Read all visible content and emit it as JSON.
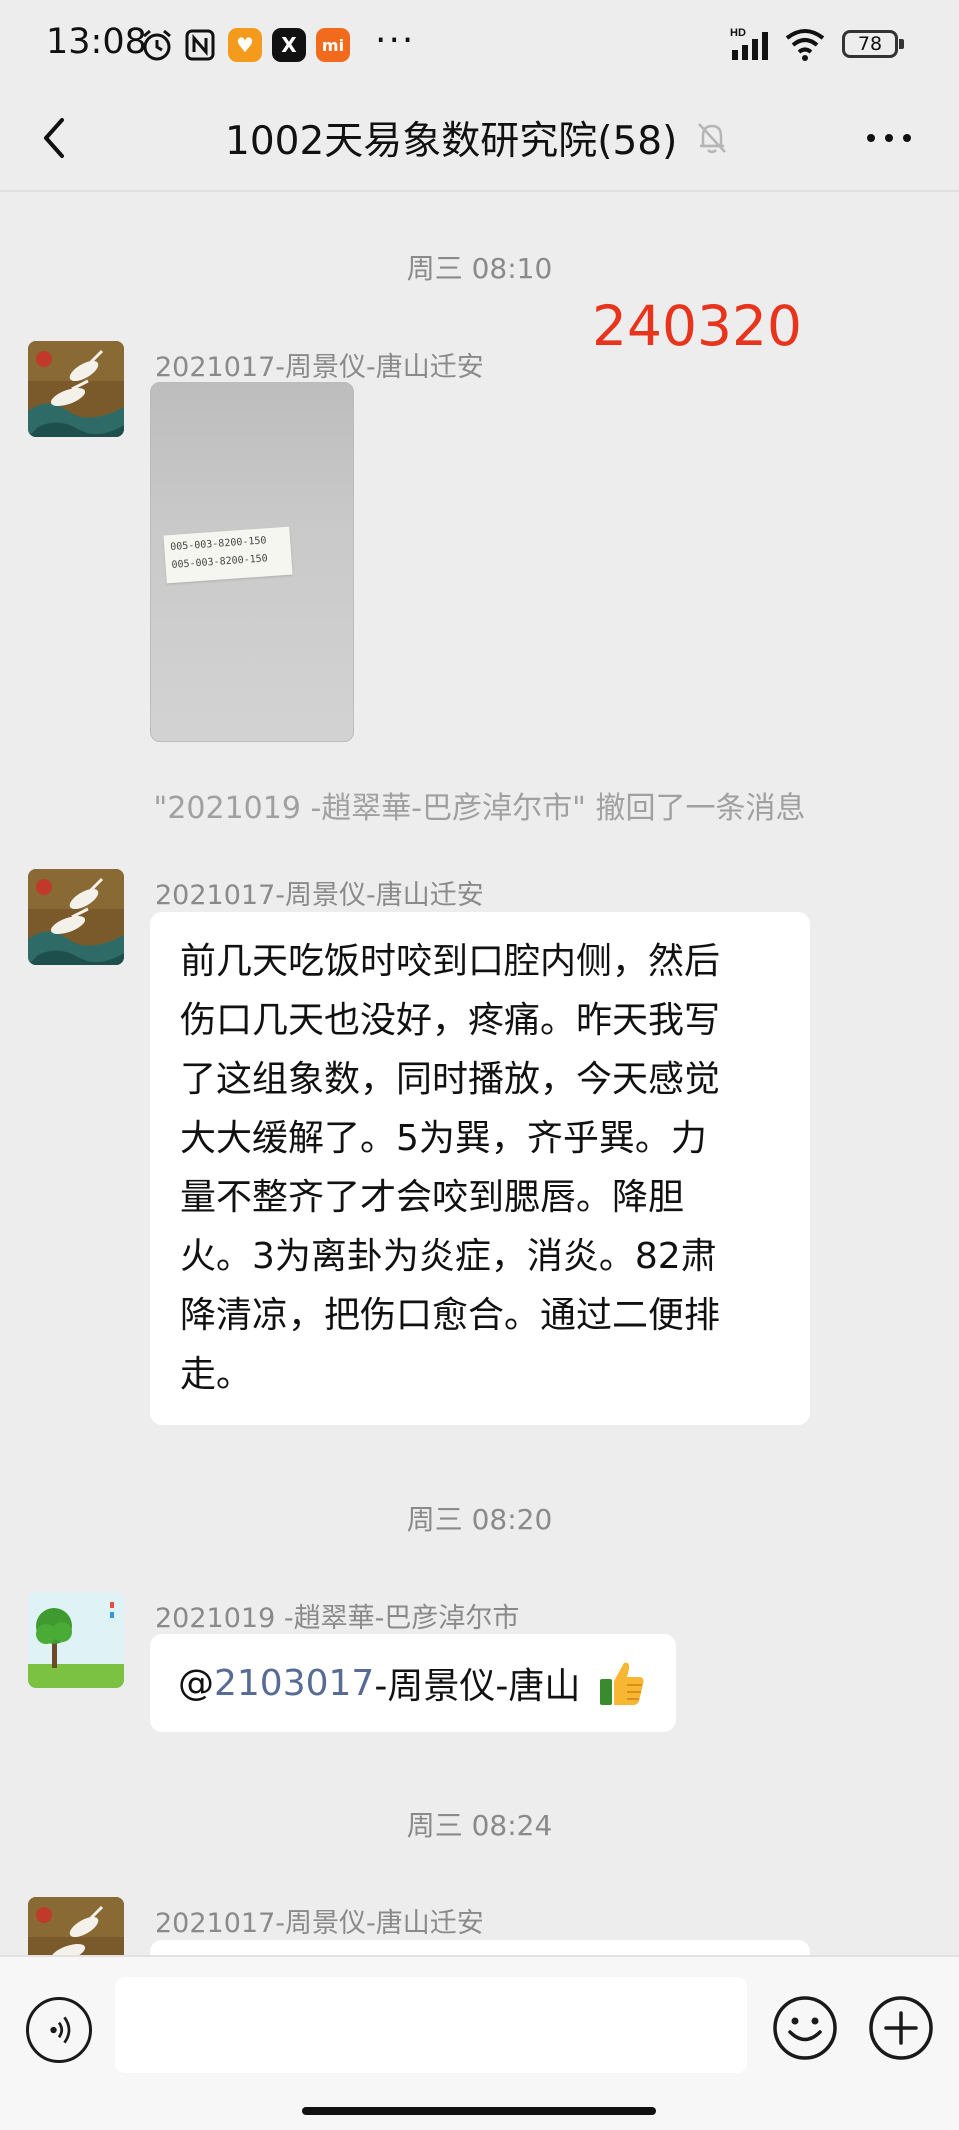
{
  "status_bar": {
    "time": "13:08",
    "battery": "78",
    "more": "···",
    "app_icon_1": "♥",
    "app_icon_2": "X",
    "app_icon_3": "mi"
  },
  "header": {
    "title": "1002天易象数研究院(58)"
  },
  "annotation": "240320",
  "messages": {
    "time_1": "周三 08:10",
    "sender_1": "2021017-周景仪-唐山迁安",
    "photo_note": [
      "005-003-8200-150",
      "005-003-8200-150"
    ],
    "system": "\"2021019 -趙翠華-巴彦淖尔市\" 撤回了一条消息",
    "sender_2": "2021017-周景仪-唐山迁安",
    "text_2_lines": [
      "前几天吃饭时咬到口腔内侧，然后",
      "伤口几天也没好，疼痛。昨天我写",
      "了这组象数，同时播放，今天感觉",
      "大大缓解了。5为巽，齐乎巽。力",
      "量不整齐了才会咬到腮唇。降胆",
      "火。3为离卦为炎症，消炎。82肃",
      "降清凉，把伤口愈合。通过二便排",
      "走。"
    ],
    "time_2": "周三 08:20",
    "sender_3": "2021019 -趙翠華-巴彦淖尔市",
    "mention_at": "@",
    "mention_name": "2103017",
    "mention_rest": "-周景仪-唐山",
    "time_3": "周三 08:24",
    "sender_4": "2021017-周景仪-唐山迁安"
  },
  "colors": {
    "background": "#ededed",
    "bubble": "#ffffff",
    "mention": "#576b95",
    "annotation": "#e8341c"
  }
}
